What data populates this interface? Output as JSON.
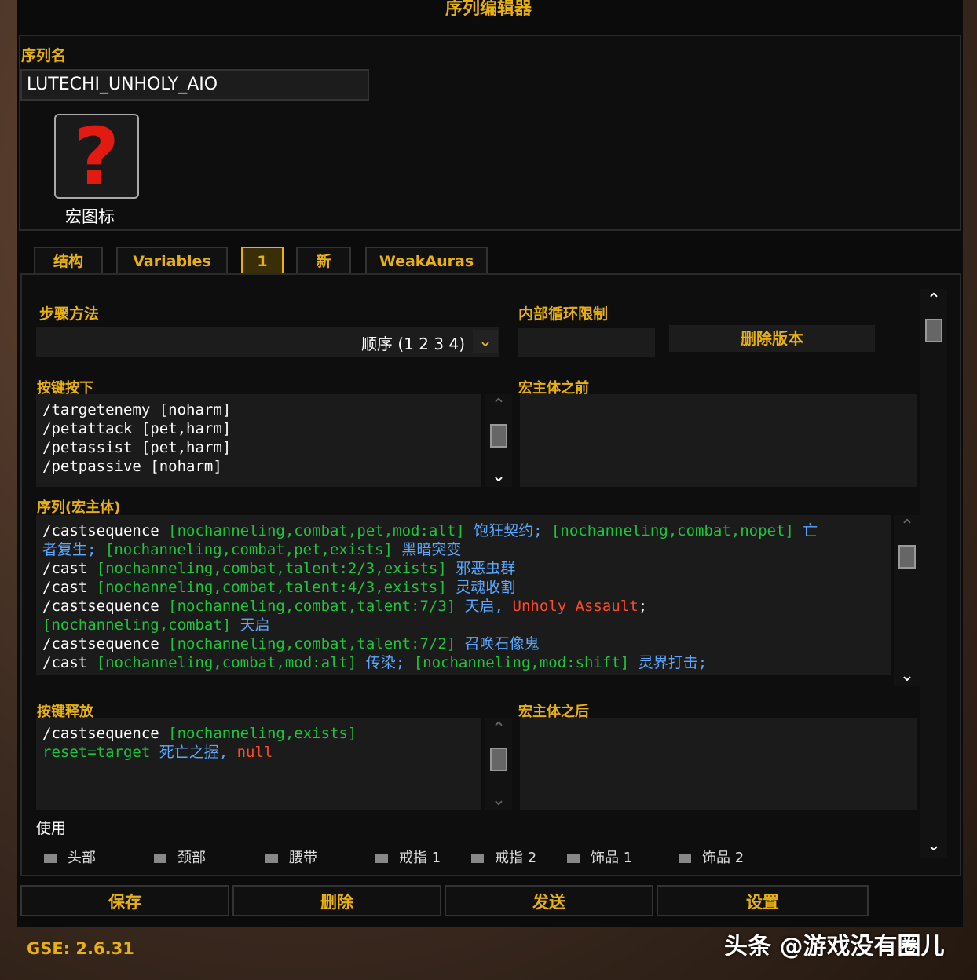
{
  "window": {
    "title": "序列编辑器"
  },
  "sequence": {
    "name_label": "序列名",
    "name_value": "LUTECHI_UNHOLY_AIO",
    "icon_label": "宏图标",
    "icon_glyph": "?"
  },
  "tabs": [
    {
      "label": "结构"
    },
    {
      "label": "Variables"
    },
    {
      "label": "1"
    },
    {
      "label": "新"
    },
    {
      "label": "WeakAuras"
    }
  ],
  "step": {
    "label": "步骤方法",
    "value": "顺序 (1 2 3 4)"
  },
  "inner_loop": {
    "label": "内部循环限制",
    "value": ""
  },
  "delete_version": "删除版本",
  "keypress": {
    "label": "按键按下",
    "lines": [
      [
        {
          "t": "/targetenemy ",
          "c": "w"
        },
        {
          "t": "[noharm]",
          "c": "w"
        }
      ],
      [
        {
          "t": "/petattack ",
          "c": "w"
        },
        {
          "t": "[pet,harm]",
          "c": "w"
        }
      ],
      [
        {
          "t": "/petassist ",
          "c": "w"
        },
        {
          "t": "[pet,harm]",
          "c": "w"
        }
      ],
      [
        {
          "t": "/petpassive ",
          "c": "w"
        },
        {
          "t": "[noharm]",
          "c": "w"
        }
      ]
    ]
  },
  "pre_macro": {
    "label": "宏主体之前"
  },
  "sequence_body": {
    "label": "序列(宏主体)",
    "lines": [
      [
        {
          "t": "/castsequence ",
          "c": "w"
        },
        {
          "t": "[nochanneling,combat,pet,mod:alt] ",
          "c": "g"
        },
        {
          "t": "饱狂契约; ",
          "c": "b"
        },
        {
          "t": "[nochanneling,combat,nopet] ",
          "c": "g"
        },
        {
          "t": "亡",
          "c": "b"
        }
      ],
      [
        {
          "t": "者复生; ",
          "c": "b"
        },
        {
          "t": "[nochanneling,combat,pet,exists] ",
          "c": "g"
        },
        {
          "t": "黑暗突变",
          "c": "b"
        }
      ],
      [
        {
          "t": "/cast ",
          "c": "w"
        },
        {
          "t": "[nochanneling,combat,talent:2/3,exists] ",
          "c": "g"
        },
        {
          "t": "邪恶虫群",
          "c": "b"
        }
      ],
      [
        {
          "t": "/cast ",
          "c": "w"
        },
        {
          "t": "[nochanneling,combat,talent:4/3,exists] ",
          "c": "g"
        },
        {
          "t": "灵魂收割",
          "c": "b"
        }
      ],
      [
        {
          "t": "/castsequence ",
          "c": "w"
        },
        {
          "t": "[nochanneling,combat,talent:7/3] ",
          "c": "g"
        },
        {
          "t": "天启, ",
          "c": "b"
        },
        {
          "t": "Unholy Assault",
          "c": "r"
        },
        {
          "t": ";",
          "c": "w"
        }
      ],
      [
        {
          "t": "[nochanneling,combat] ",
          "c": "g"
        },
        {
          "t": "天启",
          "c": "b"
        }
      ],
      [
        {
          "t": "/castsequence ",
          "c": "w"
        },
        {
          "t": "[nochanneling,combat,talent:7/2] ",
          "c": "g"
        },
        {
          "t": "召唤石像鬼",
          "c": "b"
        }
      ],
      [
        {
          "t": "/cast ",
          "c": "w"
        },
        {
          "t": "[nochanneling,combat,mod:alt] ",
          "c": "g"
        },
        {
          "t": "传染; ",
          "c": "b"
        },
        {
          "t": "[nochanneling,mod:shift] ",
          "c": "g"
        },
        {
          "t": "灵界打击;",
          "c": "b"
        }
      ]
    ]
  },
  "keyrelease": {
    "label": "按键释放",
    "lines": [
      [
        {
          "t": "/castsequence ",
          "c": "w"
        },
        {
          "t": "[nochanneling,exists]",
          "c": "g"
        }
      ],
      [
        {
          "t": "reset=target ",
          "c": "g"
        },
        {
          "t": "死亡之握, ",
          "c": "b"
        },
        {
          "t": "null",
          "c": "r"
        }
      ]
    ]
  },
  "post_macro": {
    "label": "宏主体之后"
  },
  "use": {
    "label": "使用",
    "slots": [
      "头部",
      "颈部",
      "腰带",
      "戒指 1",
      "戒指 2",
      "饰品 1",
      "饰品 2"
    ]
  },
  "buttons": {
    "save": "保存",
    "delete": "删除",
    "send": "发送",
    "settings": "设置"
  },
  "version": "GSE: 2.6.31",
  "watermark": "头条 @游戏没有圈儿",
  "colors": {
    "gold": "#e8b10f",
    "green": "#1ec43c",
    "blue": "#5aa8ff",
    "red": "#ff4a2a"
  }
}
